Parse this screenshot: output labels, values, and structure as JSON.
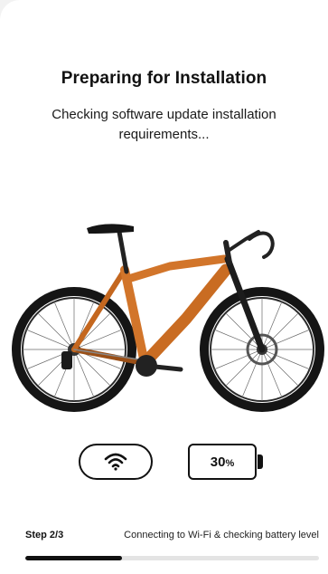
{
  "screen": {
    "title": "Preparing for Installation",
    "subtitle": "Checking software update installation requirements..."
  },
  "status": {
    "wifi_icon": "wifi-icon",
    "battery_icon": "battery-icon",
    "battery_percent": "30",
    "battery_unit": "%"
  },
  "footer": {
    "step": "Step 2/3",
    "description": "Connecting to Wi-Fi & checking battery level",
    "progress_fraction": 0.33
  },
  "colors": {
    "frame": "#d2752a",
    "frame_dark": "#9a4f17",
    "tire": "#151515",
    "accent": "#111111"
  }
}
